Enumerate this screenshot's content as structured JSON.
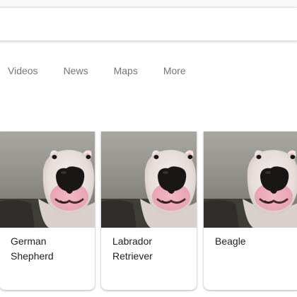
{
  "search": {
    "value": "",
    "placeholder": ""
  },
  "tabs": [
    {
      "label": "Videos"
    },
    {
      "label": "News"
    },
    {
      "label": "Maps"
    },
    {
      "label": "More"
    }
  ],
  "cards": [
    {
      "label": "German Shepherd",
      "image": "dog-photo"
    },
    {
      "label": "Labrador Retriever",
      "image": "dog-photo"
    },
    {
      "label": "Beagle",
      "image": "dog-photo"
    }
  ]
}
